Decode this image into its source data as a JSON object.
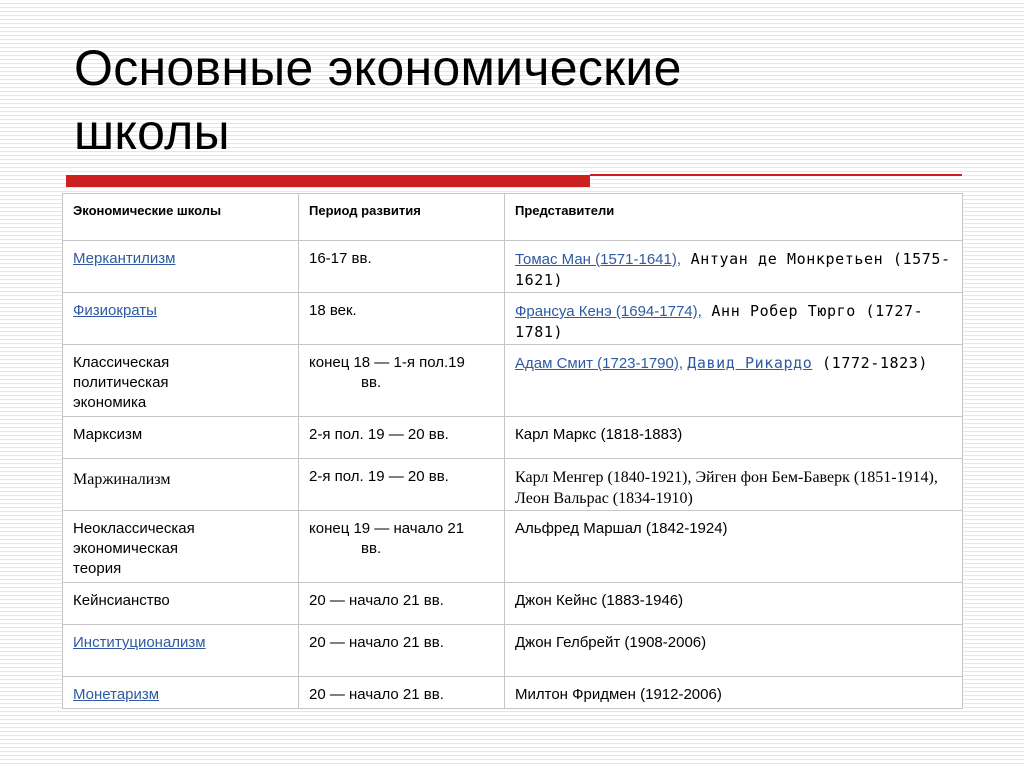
{
  "slide": {
    "title_line1": "Основные экономические",
    "title_line2": "школы",
    "accent_color": "#cc1f1f",
    "link_color": "#2f5aa3"
  },
  "table": {
    "headers": [
      "Экономические школы",
      "Период развития",
      "Представители"
    ],
    "rows": [
      {
        "school": "Меркантилизм",
        "period": "16-17 вв.",
        "rep_link": "Томас Ман (1571-1641),",
        "rep_rest": " Антуан де Монкретьен (1575-1621)"
      },
      {
        "school": "Физиократы",
        "period": "18 век.",
        "rep_link": "Франсуа Кенэ (1694-1774),",
        "rep_rest": " Анн Робер Тюрго (1727-1781)"
      },
      {
        "school_line1": "Классическая",
        "school_line2": "политическая",
        "school_line3": "экономика",
        "period_line1": "конец 18 — 1-я пол.19",
        "period_line2": "вв.",
        "rep_link": "Адам Смит (1723-1790),",
        "rep_link2": "Давид Рикардо",
        "rep_rest": " (1772-1823)"
      },
      {
        "school": "Марксизм",
        "period": "2-я пол. 19 — 20 вв.",
        "rep": "Карл Маркс (1818-1883)"
      },
      {
        "school": "Маржинализм",
        "period": "2-я пол. 19 — 20 вв.",
        "rep": "Карл Менгер (1840-1921), Эйген фон Бем-Баверк (1851-1914), Леон Вальрас (1834-1910)"
      },
      {
        "school_line1": "Неоклассическая",
        "school_line2": "экономическая",
        "school_line3": "теория",
        "period_line1": "конец 19 — начало 21",
        "period_line2": "вв.",
        "rep": "Альфред Маршал (1842-1924)"
      },
      {
        "school": "Кейнсианство",
        "period": "20 — начало 21 вв.",
        "rep": "Джон Кейнс (1883-1946)"
      },
      {
        "school": "Институционализм",
        "period": "20 — начало 21 вв.",
        "rep": "Джон Гелбрейт (1908-2006)"
      },
      {
        "school": "Монетаризм",
        "period": "20 — начало 21 вв.",
        "rep": "Милтон Фридмен (1912-2006)"
      }
    ]
  }
}
